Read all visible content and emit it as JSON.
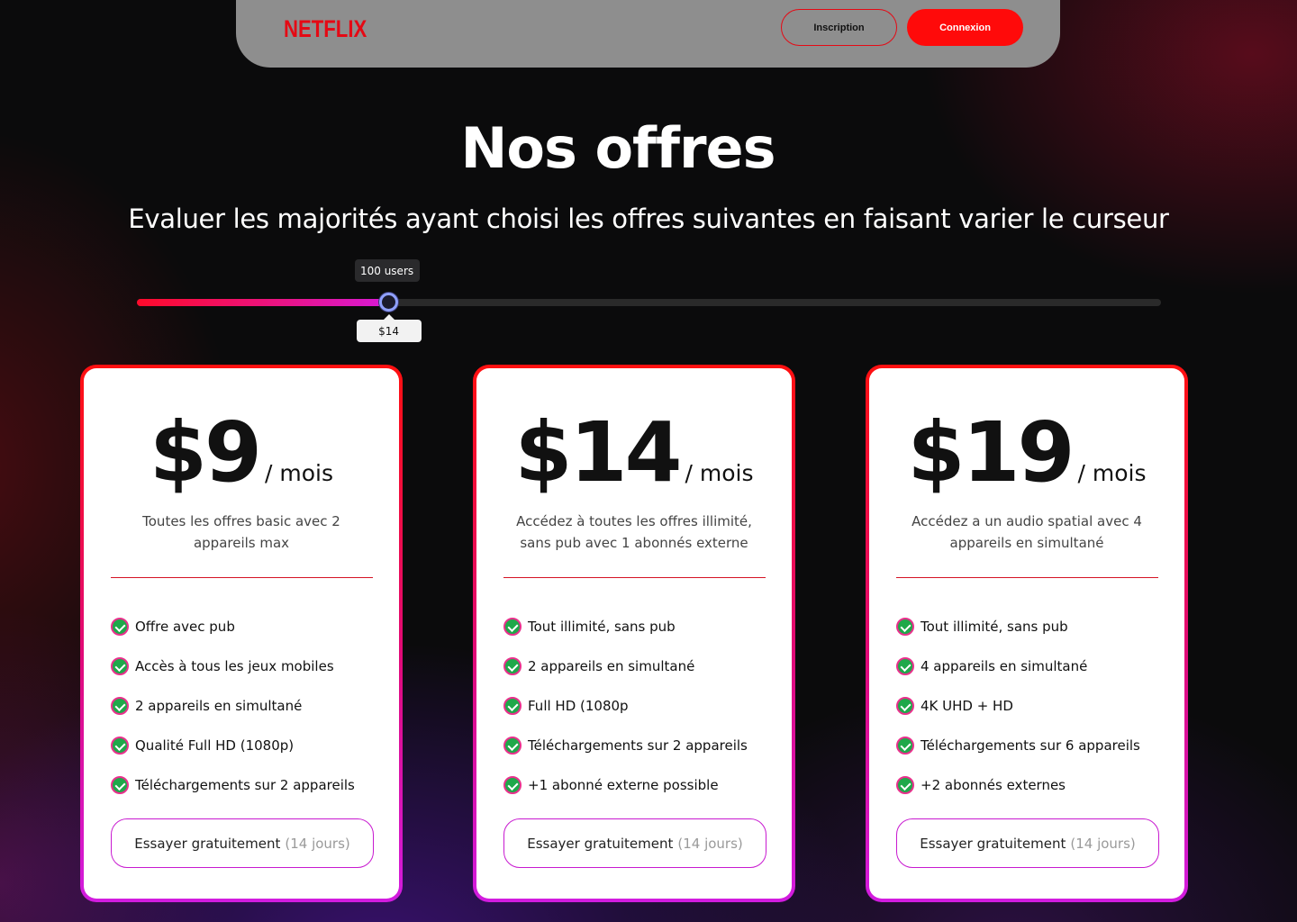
{
  "nav": {
    "logo": "NETFLIX",
    "signup_label": "Inscription",
    "login_label": "Connexion"
  },
  "hero": {
    "title": "Nos offres",
    "subtitle": "Evaluer les majorités ayant choisi les offres suivantes en faisant varier le curseur"
  },
  "slider": {
    "users_label": "100 users",
    "price_label": "$14",
    "fill_fraction": 0.245
  },
  "plans": [
    {
      "price": "$9",
      "unit": "/ mois",
      "description": "Toutes les offres basic avec 2 appareils max",
      "features": [
        "Offre avec pub",
        "Accès à tous les jeux mobiles",
        "2 appareils en simultané",
        "Qualité Full HD (1080p)",
        "Téléchargements sur 2 appareils"
      ],
      "cta": "Essayer gratuitement",
      "cta_note": "(14 jours)"
    },
    {
      "price": "$14",
      "unit": "/ mois",
      "description": "Accédez à toutes les offres illimité, sans pub avec 1 abonnés externe",
      "features": [
        "Tout illimité, sans pub",
        "2 appareils en simultané",
        "Full HD (1080p",
        "Téléchargements sur 2 appareils",
        "+1 abonné externe possible"
      ],
      "cta": "Essayer gratuitement",
      "cta_note": "(14 jours)"
    },
    {
      "price": "$19",
      "unit": "/ mois",
      "description": "Accédez a un audio spatial avec 4 appareils en simultané",
      "features": [
        "Tout illimité, sans pub",
        "4 appareils en simultané",
        "4K UHD + HD",
        "Téléchargements sur 6 appareils",
        "+2 abonnés externes"
      ],
      "cta": "Essayer gratuitement",
      "cta_note": "(14 jours)"
    }
  ],
  "colors": {
    "brand": "#e50914",
    "accent_gradient_start": "#ff0a2a",
    "accent_gradient_end": "#d21ce0",
    "check": "#1fa84a"
  }
}
